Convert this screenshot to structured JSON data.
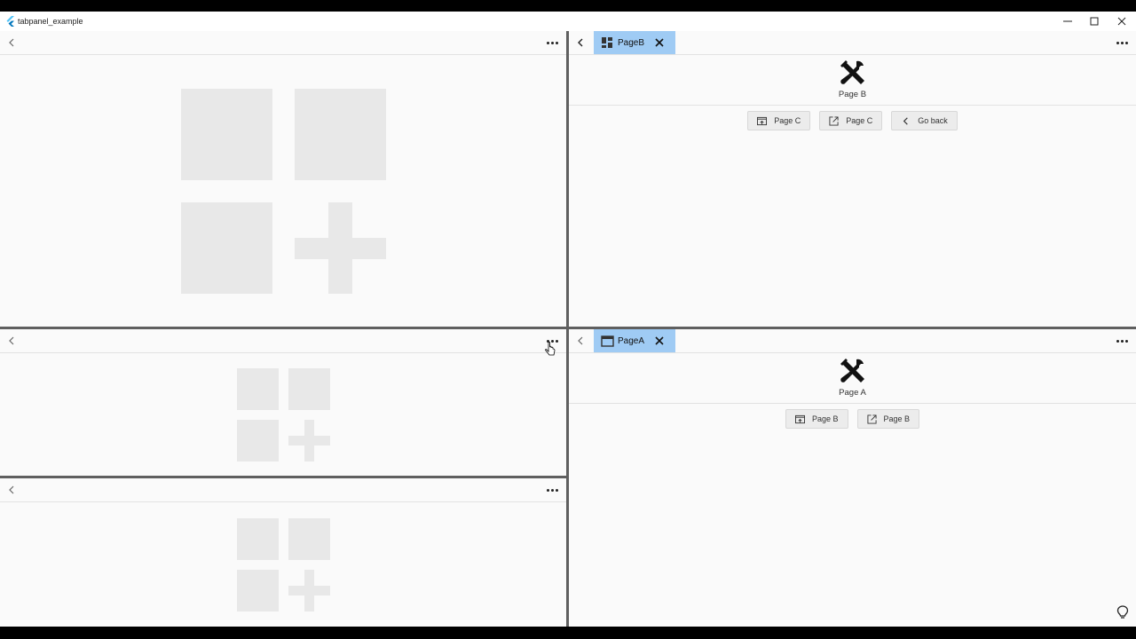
{
  "window": {
    "title": "tabpanel_example",
    "controls": {
      "minimize": "minimize-icon",
      "maximize": "maximize-icon",
      "close": "close-icon"
    }
  },
  "panels": {
    "top_left": {
      "empty": true,
      "back_icon": "chevron-left-icon",
      "menu_icon": "more-horizontal-icon"
    },
    "middle_left": {
      "empty": true
    },
    "bottom_left": {
      "empty": true
    },
    "top_right": {
      "tab": {
        "label": "PageB",
        "icon": "dashboard-icon",
        "close_icon": "close-icon"
      },
      "page_title": "Page B",
      "buttons": [
        {
          "label": "Page C",
          "icon": "open-in-tab-icon"
        },
        {
          "label": "Page C",
          "icon": "open-in-new-icon"
        },
        {
          "label": "Go back",
          "icon": "chevron-left-icon"
        }
      ]
    },
    "bottom_right": {
      "tab": {
        "label": "PageA",
        "icon": "web-asset-icon",
        "close_icon": "close-icon"
      },
      "page_title": "Page A",
      "buttons": [
        {
          "label": "Page B",
          "icon": "open-in-tab-icon"
        },
        {
          "label": "Page B",
          "icon": "open-in-new-icon"
        }
      ]
    }
  },
  "colors": {
    "tab_active": "#9fcbf4",
    "divider": "#5f5f5f",
    "placeholder": "#e8e8e8",
    "background": "#fafafa"
  }
}
